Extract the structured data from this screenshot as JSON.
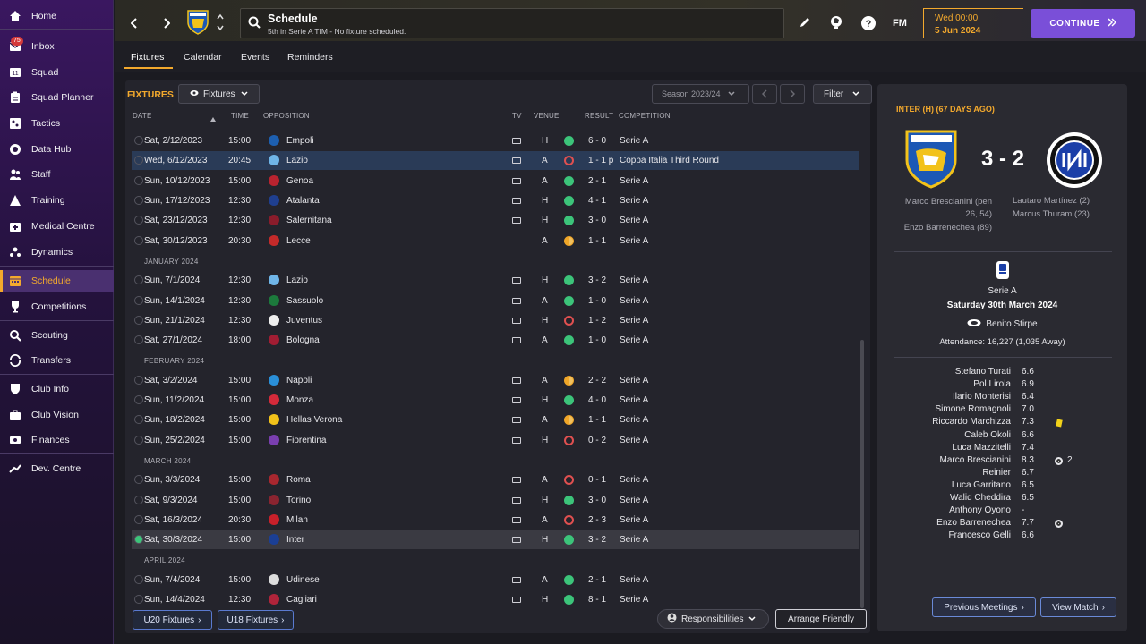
{
  "sidebar": {
    "items": [
      {
        "label": "Home",
        "icon": "home-icon"
      },
      {
        "label": "Inbox",
        "icon": "inbox-icon",
        "badge": "75"
      },
      {
        "label": "Squad",
        "icon": "squad-icon"
      },
      {
        "label": "Squad Planner",
        "icon": "clipboard-icon"
      },
      {
        "label": "Tactics",
        "icon": "tactics-icon"
      },
      {
        "label": "Data Hub",
        "icon": "data-hub-icon"
      },
      {
        "label": "Staff",
        "icon": "staff-icon"
      },
      {
        "label": "Training",
        "icon": "training-icon"
      },
      {
        "label": "Medical Centre",
        "icon": "medical-icon"
      },
      {
        "label": "Dynamics",
        "icon": "dynamics-icon"
      },
      {
        "label": "Schedule",
        "icon": "calendar-icon"
      },
      {
        "label": "Competitions",
        "icon": "trophy-icon"
      },
      {
        "label": "Scouting",
        "icon": "scouting-icon"
      },
      {
        "label": "Transfers",
        "icon": "transfers-icon"
      },
      {
        "label": "Club Info",
        "icon": "shield-icon"
      },
      {
        "label": "Club Vision",
        "icon": "briefcase-icon"
      },
      {
        "label": "Finances",
        "icon": "money-icon"
      },
      {
        "label": "Dev. Centre",
        "icon": "dev-centre-icon"
      }
    ]
  },
  "header": {
    "title": "Schedule",
    "subtitle": "5th in Serie A TIM - No fixture scheduled.",
    "date_line1": "Wed 00:00",
    "date_line2": "5 Jun 2024",
    "continue_label": "CONTINUE",
    "fm_label": "FM"
  },
  "tabs": [
    "Fixtures",
    "Calendar",
    "Events",
    "Reminders"
  ],
  "fixtures_panel": {
    "title": "FIXTURES",
    "view_label": "Fixtures",
    "season_label": "Season 2023/24",
    "filter_label": "Filter"
  },
  "columns": {
    "date": "DATE",
    "time": "TIME",
    "opposition": "OPPOSITION",
    "tv": "TV",
    "venue": "VENUE",
    "result": "RESULT",
    "competition": "COMPETITION"
  },
  "months": [
    "JANUARY 2024",
    "FEBRUARY 2024",
    "MARCH 2024",
    "APRIL 2024"
  ],
  "fixtures": [
    {
      "date": "Sat, 2/12/2023",
      "time": "15:00",
      "opp": "Empoli",
      "venue": "H",
      "outcome": "win",
      "score": "6 - 0",
      "comp": "Serie A",
      "tv": true,
      "crest": "#1d5fb0"
    },
    {
      "date": "Wed, 6/12/2023",
      "time": "20:45",
      "opp": "Lazio",
      "venue": "A",
      "outcome": "loss",
      "score": "1 - 1 p",
      "comp": "Coppa Italia Third Round",
      "tv": true,
      "crest": "#6fb5e8"
    },
    {
      "date": "Sun, 10/12/2023",
      "time": "15:00",
      "opp": "Genoa",
      "venue": "A",
      "outcome": "win",
      "score": "2 - 1",
      "comp": "Serie A",
      "tv": true,
      "crest": "#b8232f"
    },
    {
      "date": "Sun, 17/12/2023",
      "time": "12:30",
      "opp": "Atalanta",
      "venue": "H",
      "outcome": "win",
      "score": "4 - 1",
      "comp": "Serie A",
      "tv": true,
      "crest": "#1f3f8f"
    },
    {
      "date": "Sat, 23/12/2023",
      "time": "12:30",
      "opp": "Salernitana",
      "venue": "H",
      "outcome": "win",
      "score": "3 - 0",
      "comp": "Serie A",
      "tv": true,
      "crest": "#8a1c2b"
    },
    {
      "date": "Sat, 30/12/2023",
      "time": "20:30",
      "opp": "Lecce",
      "venue": "A",
      "outcome": "draw",
      "score": "1 - 1",
      "comp": "Serie A",
      "tv": false,
      "crest": "#c42a2a"
    },
    {
      "date": "Sun, 7/1/2024",
      "time": "12:30",
      "opp": "Lazio",
      "venue": "H",
      "outcome": "win",
      "score": "3 - 2",
      "comp": "Serie A",
      "tv": true,
      "crest": "#6fb5e8"
    },
    {
      "date": "Sun, 14/1/2024",
      "time": "12:30",
      "opp": "Sassuolo",
      "venue": "A",
      "outcome": "win",
      "score": "1 - 0",
      "comp": "Serie A",
      "tv": true,
      "crest": "#1c7a3c"
    },
    {
      "date": "Sun, 21/1/2024",
      "time": "12:30",
      "opp": "Juventus",
      "venue": "H",
      "outcome": "loss",
      "score": "1 - 2",
      "comp": "Serie A",
      "tv": true,
      "crest": "#eeeeee"
    },
    {
      "date": "Sat, 27/1/2024",
      "time": "18:00",
      "opp": "Bologna",
      "venue": "A",
      "outcome": "win",
      "score": "1 - 0",
      "comp": "Serie A",
      "tv": true,
      "crest": "#a11d33"
    },
    {
      "date": "Sat, 3/2/2024",
      "time": "15:00",
      "opp": "Napoli",
      "venue": "A",
      "outcome": "draw",
      "score": "2 - 2",
      "comp": "Serie A",
      "tv": true,
      "crest": "#2a8fd8"
    },
    {
      "date": "Sun, 11/2/2024",
      "time": "15:00",
      "opp": "Monza",
      "venue": "H",
      "outcome": "win",
      "score": "4 - 0",
      "comp": "Serie A",
      "tv": true,
      "crest": "#d42a3a"
    },
    {
      "date": "Sun, 18/2/2024",
      "time": "15:00",
      "opp": "Hellas Verona",
      "venue": "A",
      "outcome": "draw",
      "score": "1 - 1",
      "comp": "Serie A",
      "tv": true,
      "crest": "#f2c21a"
    },
    {
      "date": "Sun, 25/2/2024",
      "time": "15:00",
      "opp": "Fiorentina",
      "venue": "H",
      "outcome": "loss",
      "score": "0 - 2",
      "comp": "Serie A",
      "tv": true,
      "crest": "#7a3fb0"
    },
    {
      "date": "Sun, 3/3/2024",
      "time": "15:00",
      "opp": "Roma",
      "venue": "A",
      "outcome": "loss",
      "score": "0 - 1",
      "comp": "Serie A",
      "tv": true,
      "crest": "#a8272f"
    },
    {
      "date": "Sat, 9/3/2024",
      "time": "15:00",
      "opp": "Torino",
      "venue": "H",
      "outcome": "win",
      "score": "3 - 0",
      "comp": "Serie A",
      "tv": true,
      "crest": "#8a2430"
    },
    {
      "date": "Sat, 16/3/2024",
      "time": "20:30",
      "opp": "Milan",
      "venue": "A",
      "outcome": "loss",
      "score": "2 - 3",
      "comp": "Serie A",
      "tv": true,
      "crest": "#c8202a"
    },
    {
      "date": "Sat, 30/3/2024",
      "time": "15:00",
      "opp": "Inter",
      "venue": "H",
      "outcome": "win",
      "score": "3 - 2",
      "comp": "Serie A",
      "tv": true,
      "crest": "#1b3f95"
    },
    {
      "date": "Sun, 7/4/2024",
      "time": "15:00",
      "opp": "Udinese",
      "venue": "A",
      "outcome": "win",
      "score": "2 - 1",
      "comp": "Serie A",
      "tv": true,
      "crest": "#dddddd"
    },
    {
      "date": "Sun, 14/4/2024",
      "time": "12:30",
      "opp": "Cagliari",
      "venue": "H",
      "outcome": "win",
      "score": "8 - 1",
      "comp": "Serie A",
      "tv": true,
      "crest": "#b0243a"
    }
  ],
  "bottom_buttons": {
    "u20": "U20 Fixtures",
    "u18": "U18 Fixtures",
    "responsibilities": "Responsibilities",
    "arrange": "Arrange Friendly"
  },
  "match": {
    "header": "INTER (H) (67 DAYS AGO)",
    "score": "3 - 2",
    "home_scorers": "Marco Brescianini (pen 26, 54)",
    "home_scorers2": "Enzo Barrenechea (89)",
    "away_scorers": "Lautaro Martínez (2)",
    "away_scorers2": "Marcus Thuram (23)",
    "competition": "Serie A",
    "date": "Saturday 30th March 2024",
    "stadium": "Benito Stirpe",
    "attendance": "Attendance: 16,227 (1,035 Away)",
    "players": [
      {
        "name": "Stefano Turati",
        "rating": "6.6",
        "extra": ""
      },
      {
        "name": "Pol Lirola",
        "rating": "6.9",
        "extra": ""
      },
      {
        "name": "Ilario Monterisi",
        "rating": "6.4",
        "extra": ""
      },
      {
        "name": "Simone Romagnoli",
        "rating": "7.0",
        "extra": ""
      },
      {
        "name": "Riccardo Marchizza",
        "rating": "7.3",
        "extra": "yellow"
      },
      {
        "name": "Caleb Okoli",
        "rating": "6.6",
        "extra": ""
      },
      {
        "name": "Luca Mazzitelli",
        "rating": "7.4",
        "extra": ""
      },
      {
        "name": "Marco Brescianini",
        "rating": "8.3",
        "extra": "goal",
        "goals": "2"
      },
      {
        "name": "Reinier",
        "rating": "6.7",
        "extra": ""
      },
      {
        "name": "Luca Garritano",
        "rating": "6.5",
        "extra": ""
      },
      {
        "name": "Walid Cheddira",
        "rating": "6.5",
        "extra": ""
      },
      {
        "name": "Anthony Oyono",
        "rating": "-",
        "extra": ""
      },
      {
        "name": "Enzo Barrenechea",
        "rating": "7.7",
        "extra": "goal"
      },
      {
        "name": "Francesco Gelli",
        "rating": "6.6",
        "extra": ""
      }
    ],
    "prev_meetings": "Previous Meetings",
    "view_match": "View Match"
  },
  "colors": {
    "accent": "#f3a92d",
    "continue": "#7a4fd8",
    "win": "#3cc47a",
    "loss": "#e05050",
    "draw": "#f0a628"
  }
}
